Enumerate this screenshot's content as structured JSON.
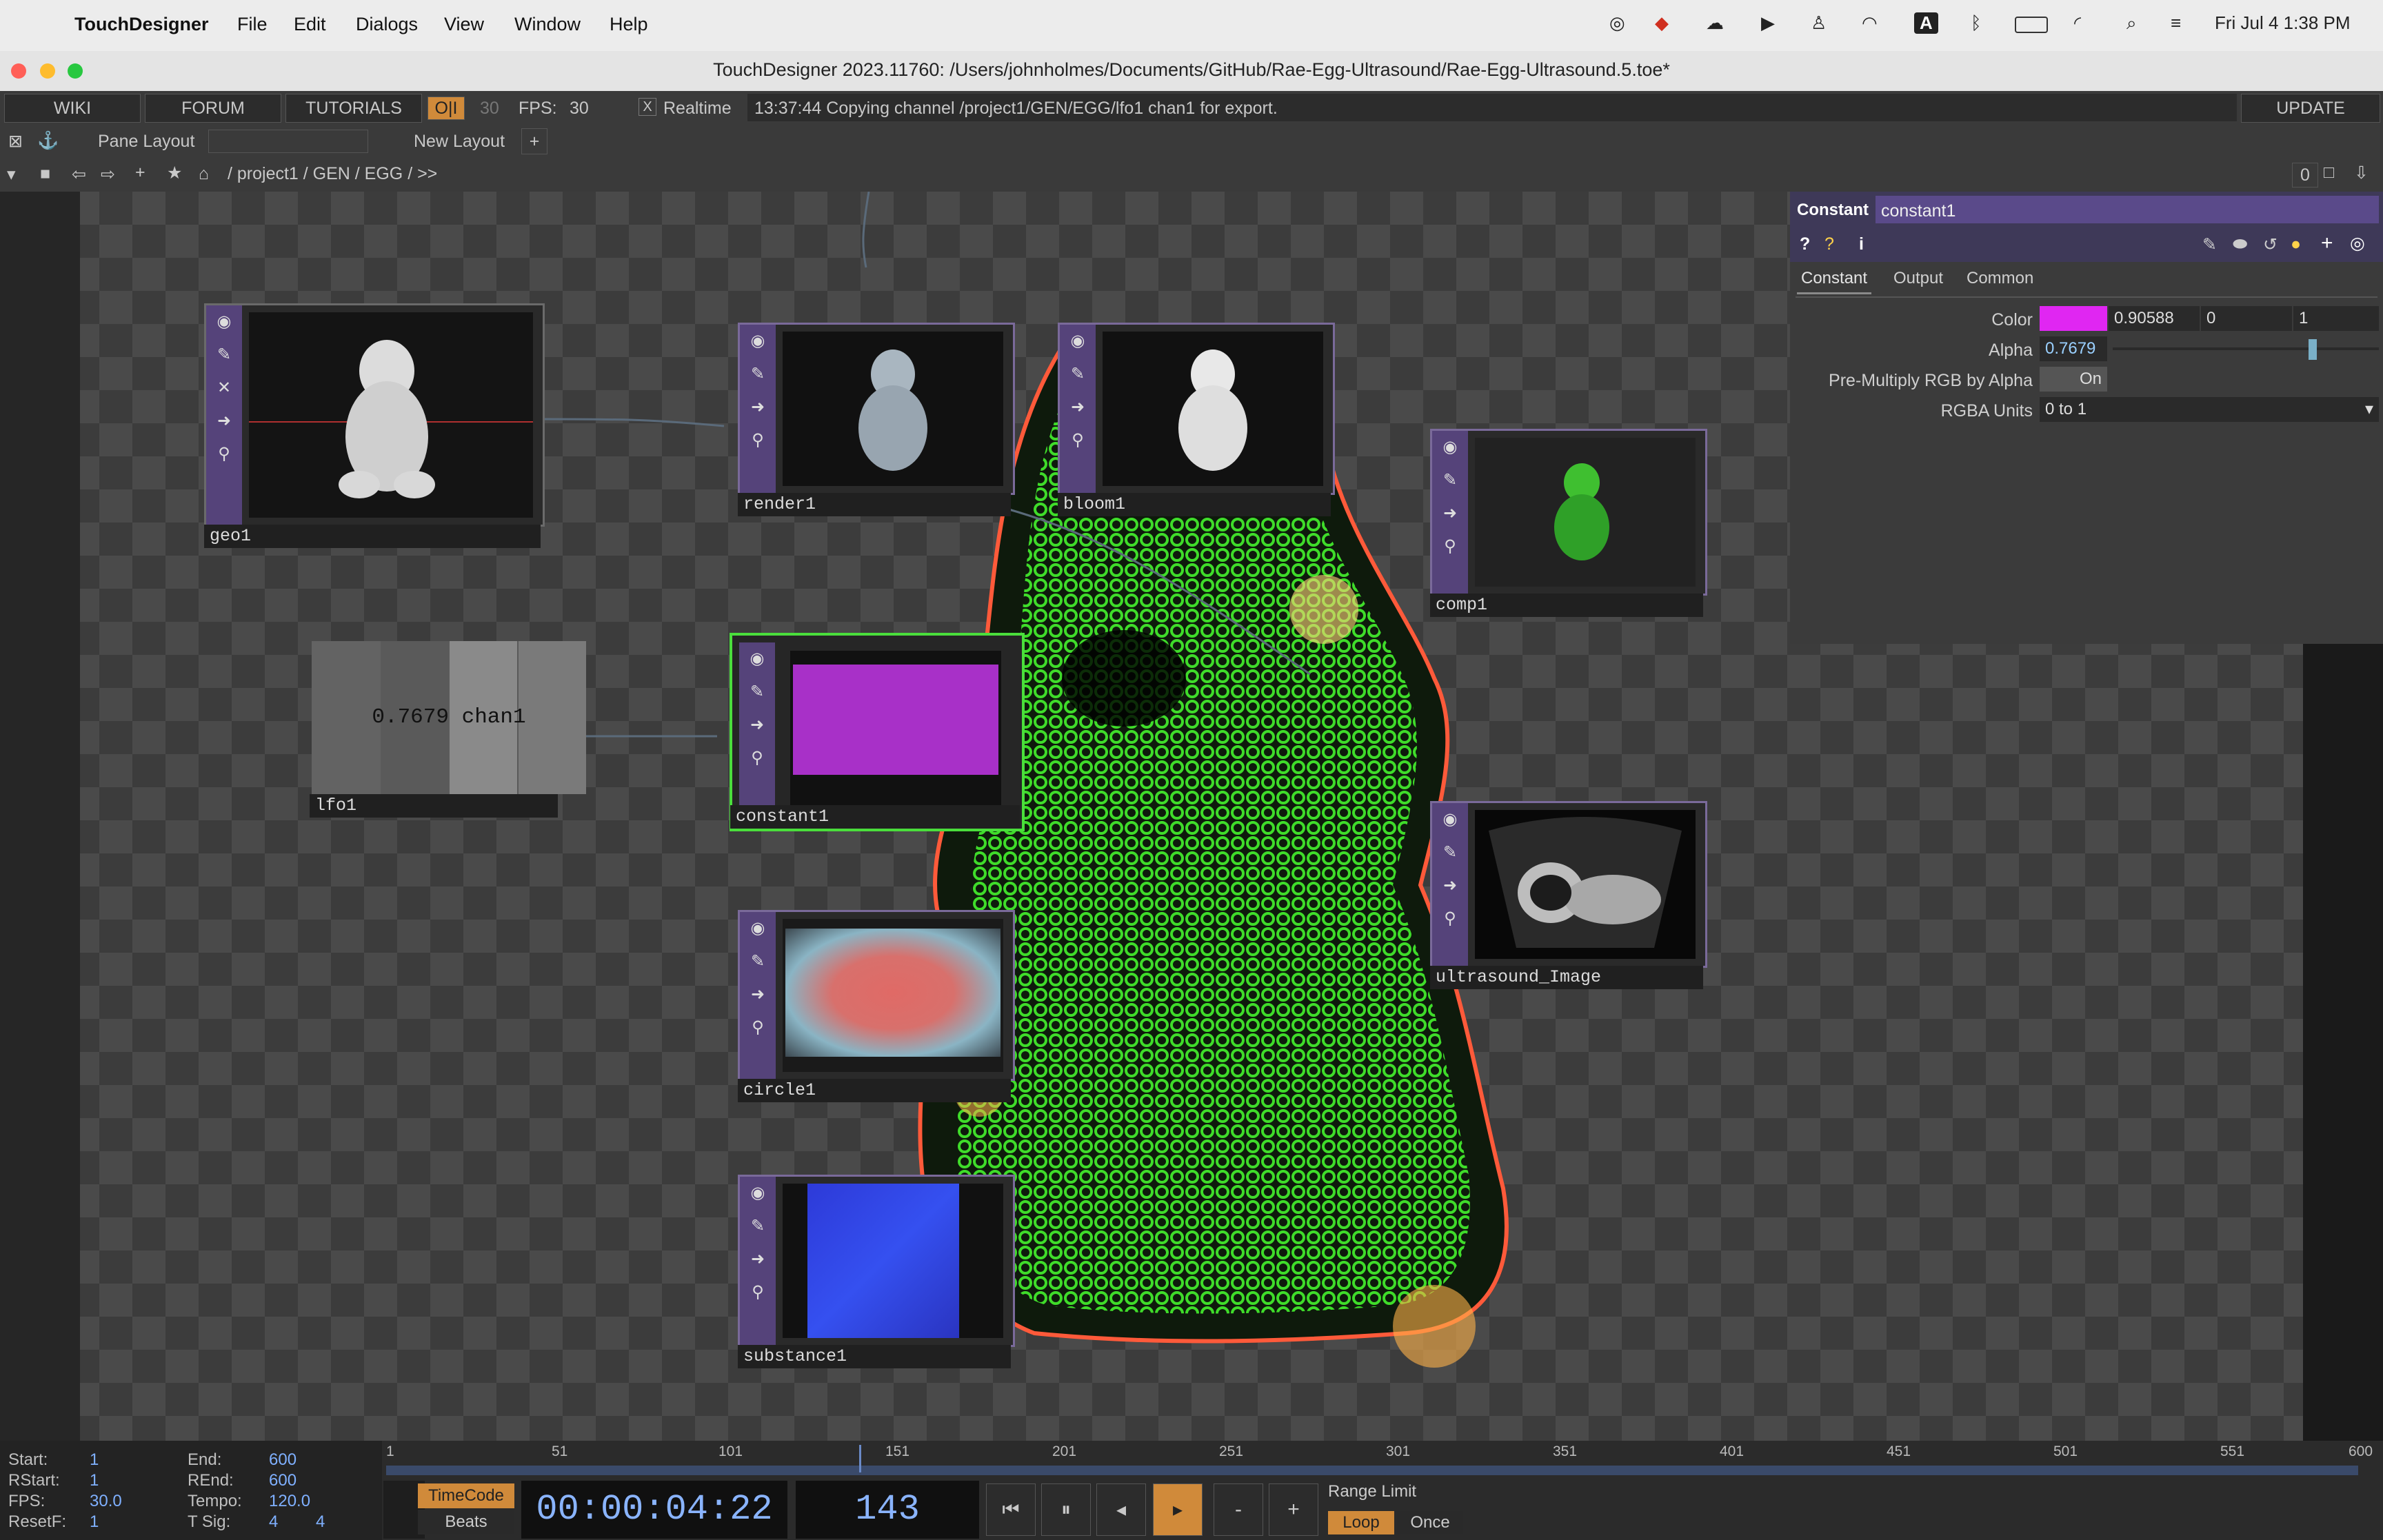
{
  "menubar": {
    "app": "TouchDesigner",
    "menus": [
      "File",
      "Edit",
      "Dialogs",
      "View",
      "Window",
      "Help"
    ],
    "datetime": "Fri Jul 4  1:38 PM",
    "input_badge": "A"
  },
  "window": {
    "title": "TouchDesigner 2023.11760: /Users/johnholmes/Documents/GitHub/Rae-Egg-Ultrasound/Rae-Egg-Ultrasound.5.toe*"
  },
  "topbar": {
    "wiki": "WIKI",
    "forum": "FORUM",
    "tutorials": "TUTORIALS",
    "oi": "O|I",
    "fps_cap": "30",
    "fps_label": "FPS:",
    "fps_value": "30",
    "realtime_check": "X",
    "realtime": "Realtime",
    "message": "13:37:44 Copying channel /project1/GEN/EGG/lfo1 chan1 for export.",
    "update": "UPDATE"
  },
  "layoutbar": {
    "pane_layout": "Pane Layout",
    "new_layout": "New Layout",
    "plus": "+"
  },
  "pathbar": {
    "path": "/ project1 / GEN / EGG / >>",
    "counter": "0"
  },
  "nodes": {
    "geo1": "geo1",
    "render1": "render1",
    "bloom1": "bloom1",
    "comp1": "comp1",
    "lfo1": "lfo1",
    "lfo1_value": "0.7679 chan1",
    "constant1": "constant1",
    "circle1": "circle1",
    "substance1": "substance1",
    "ultrasound": "ultrasound_Image"
  },
  "params": {
    "type": "Constant",
    "name": "constant1",
    "tabs": [
      "Constant",
      "Output",
      "Common"
    ],
    "color_label": "Color",
    "color_r": "0.90588",
    "color_g": "0",
    "color_b": "1",
    "alpha_label": "Alpha",
    "alpha_value": "0.7679",
    "premult_label": "Pre-Multiply RGB by Alpha",
    "premult_value": "On",
    "units_label": "RGBA Units",
    "units_value": "0 to 1",
    "swatch_color": "#e026f2"
  },
  "timeline": {
    "start_l": "Start:",
    "start": "1",
    "end_l": "End:",
    "end": "600",
    "rstart_l": "RStart:",
    "rstart": "1",
    "rend_l": "REnd:",
    "rend": "600",
    "fps_l": "FPS:",
    "fps": "30.0",
    "tempo_l": "Tempo:",
    "tempo": "120.0",
    "resetf_l": "ResetF:",
    "resetf": "1",
    "tsig_l": "T Sig:",
    "tsig_a": "4",
    "tsig_b": "4",
    "ticks": [
      "1",
      "51",
      "101",
      "151",
      "201",
      "251",
      "301",
      "351",
      "401",
      "451",
      "501",
      "551",
      "600"
    ],
    "timecode_btn": "TimeCode",
    "beats_btn": "Beats",
    "timecode": "00:00:04:22",
    "frame": "143",
    "range_limit": "Range Limit",
    "loop": "Loop",
    "once": "Once",
    "minus": "-",
    "plus": "+"
  }
}
